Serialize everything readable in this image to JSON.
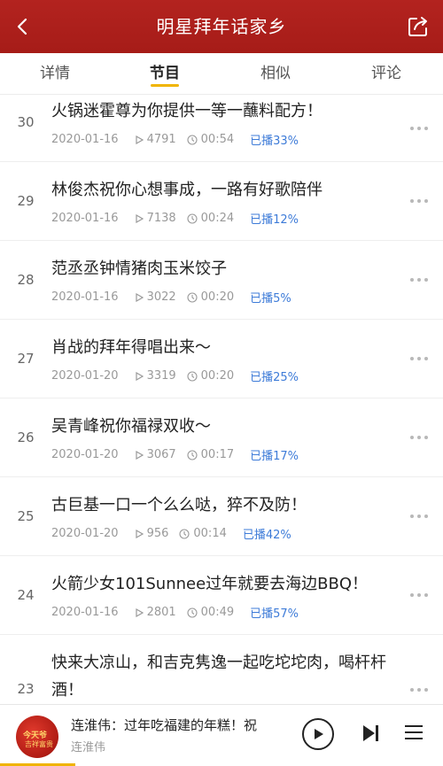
{
  "header": {
    "title": "明星拜年话家乡"
  },
  "tabs": [
    {
      "label": "详情",
      "active": false
    },
    {
      "label": "节目",
      "active": true
    },
    {
      "label": "相似",
      "active": false
    },
    {
      "label": "评论",
      "active": false
    }
  ],
  "episodes": [
    {
      "num": "30",
      "title": "火锅迷霍尊为你提供一等一蘸料配方！",
      "date": "2020-01-16",
      "plays": "4791",
      "duration": "00:54",
      "played": "已播33%"
    },
    {
      "num": "29",
      "title": "林俊杰祝你心想事成，一路有好歌陪伴",
      "date": "2020-01-16",
      "plays": "7138",
      "duration": "00:24",
      "played": "已播12%"
    },
    {
      "num": "28",
      "title": "范丞丞钟情猪肉玉米饺子",
      "date": "2020-01-16",
      "plays": "3022",
      "duration": "00:20",
      "played": "已播5%"
    },
    {
      "num": "27",
      "title": "肖战的拜年得唱出来～",
      "date": "2020-01-20",
      "plays": "3319",
      "duration": "00:20",
      "played": "已播25%"
    },
    {
      "num": "26",
      "title": "吴青峰祝你福禄双收～",
      "date": "2020-01-20",
      "plays": "3067",
      "duration": "00:17",
      "played": "已播17%"
    },
    {
      "num": "25",
      "title": "古巨基一口一个么么哒，猝不及防！",
      "date": "2020-01-20",
      "plays": "956",
      "duration": "00:14",
      "played": "已播42%"
    },
    {
      "num": "24",
      "title": "火箭少女101Sunnee过年就要去海边BBQ！",
      "date": "2020-01-16",
      "plays": "2801",
      "duration": "00:49",
      "played": "已播57%"
    },
    {
      "num": "23",
      "title": "快来大凉山，和吉克隽逸一起吃坨坨肉，喝杆杆酒！",
      "date": "",
      "plays": "",
      "duration": "",
      "played": ""
    }
  ],
  "player": {
    "title": "连淮伟：过年吃福建的年糕！祝",
    "artist": "连淮伟",
    "cover_text_1": "今天爷",
    "cover_text_2": "吉祥富贵",
    "progress_fraction": 0.17
  },
  "colors": {
    "header_red": "#a61c18",
    "accent_yellow": "#f0b400",
    "played_blue": "#3d7bd8"
  }
}
